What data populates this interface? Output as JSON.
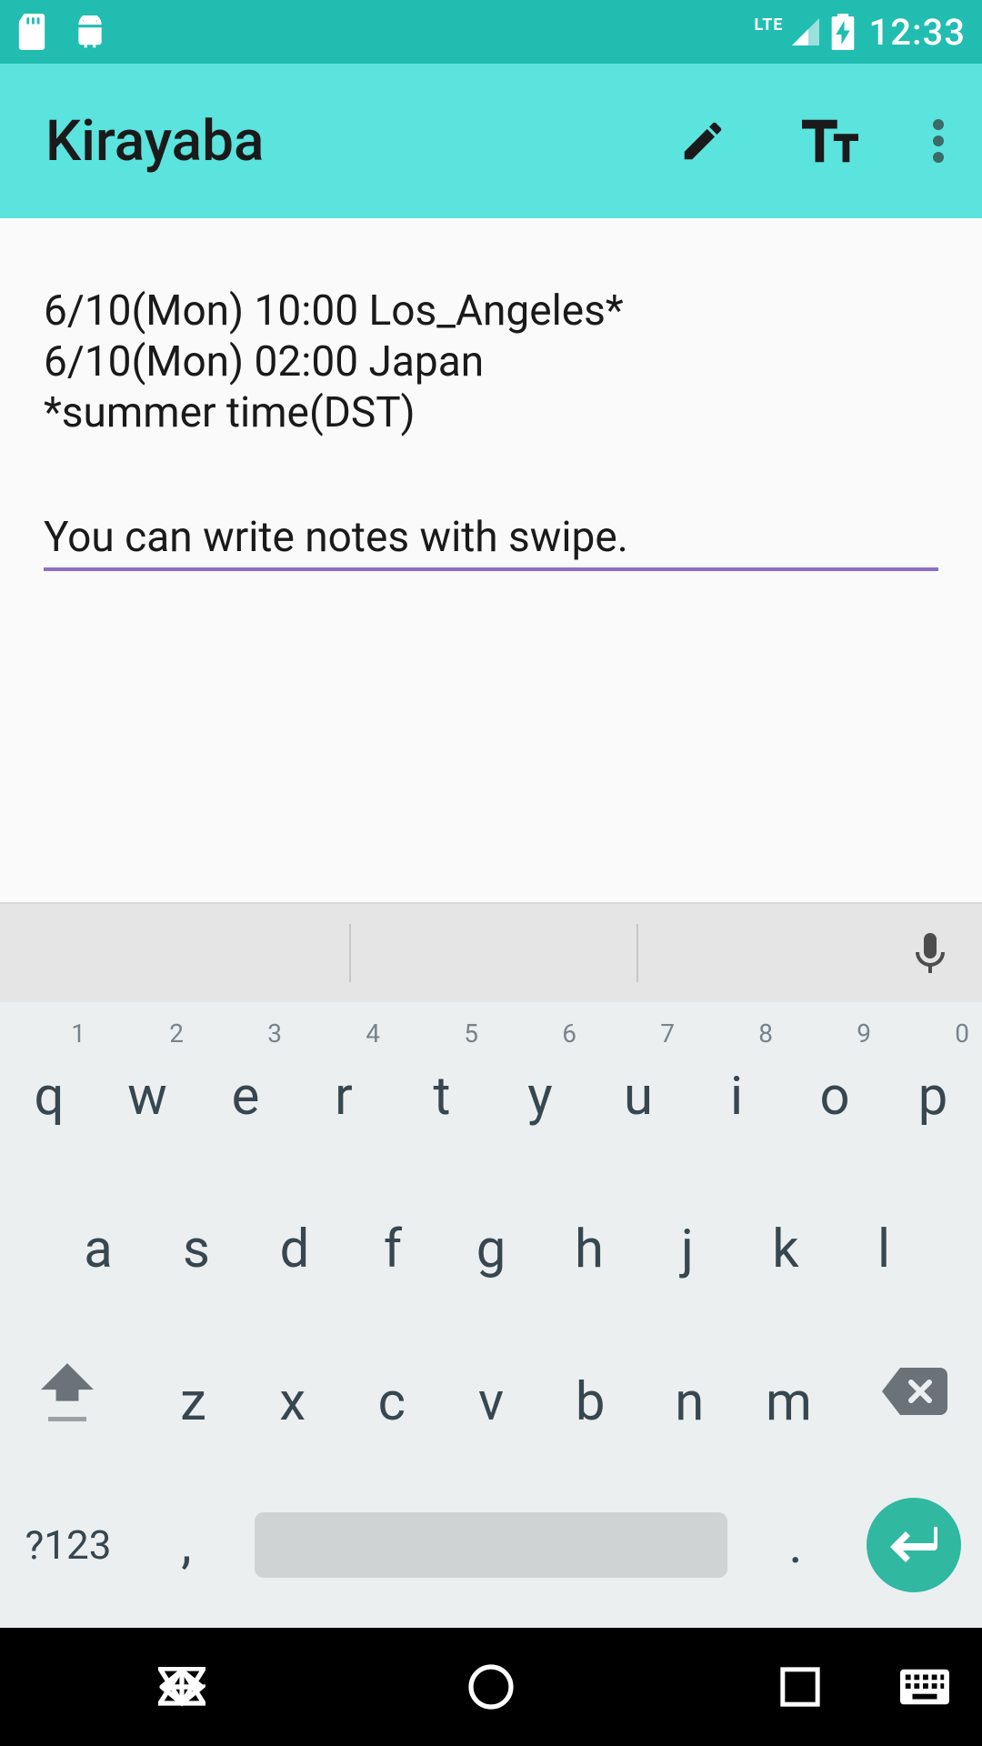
{
  "status": {
    "time": "12:33",
    "lte": "LTE"
  },
  "appbar": {
    "title": "Kirayaba"
  },
  "content": {
    "line1": "6/10(Mon) 10:00 Los_Angeles*",
    "line2": "6/10(Mon) 02:00 Japan",
    "line3": "*summer time(DST)",
    "input_value": "You can write notes with swipe."
  },
  "keyboard": {
    "row1": [
      {
        "main": "q",
        "hint": "1"
      },
      {
        "main": "w",
        "hint": "2"
      },
      {
        "main": "e",
        "hint": "3"
      },
      {
        "main": "r",
        "hint": "4"
      },
      {
        "main": "t",
        "hint": "5"
      },
      {
        "main": "y",
        "hint": "6"
      },
      {
        "main": "u",
        "hint": "7"
      },
      {
        "main": "i",
        "hint": "8"
      },
      {
        "main": "o",
        "hint": "9"
      },
      {
        "main": "p",
        "hint": "0"
      }
    ],
    "row2": [
      {
        "main": "a"
      },
      {
        "main": "s"
      },
      {
        "main": "d"
      },
      {
        "main": "f"
      },
      {
        "main": "g"
      },
      {
        "main": "h"
      },
      {
        "main": "j"
      },
      {
        "main": "k"
      },
      {
        "main": "l"
      }
    ],
    "row3": [
      {
        "main": "z"
      },
      {
        "main": "x"
      },
      {
        "main": "c"
      },
      {
        "main": "v"
      },
      {
        "main": "b"
      },
      {
        "main": "n"
      },
      {
        "main": "m"
      }
    ],
    "sym": "?123",
    "comma": ",",
    "period": "."
  }
}
